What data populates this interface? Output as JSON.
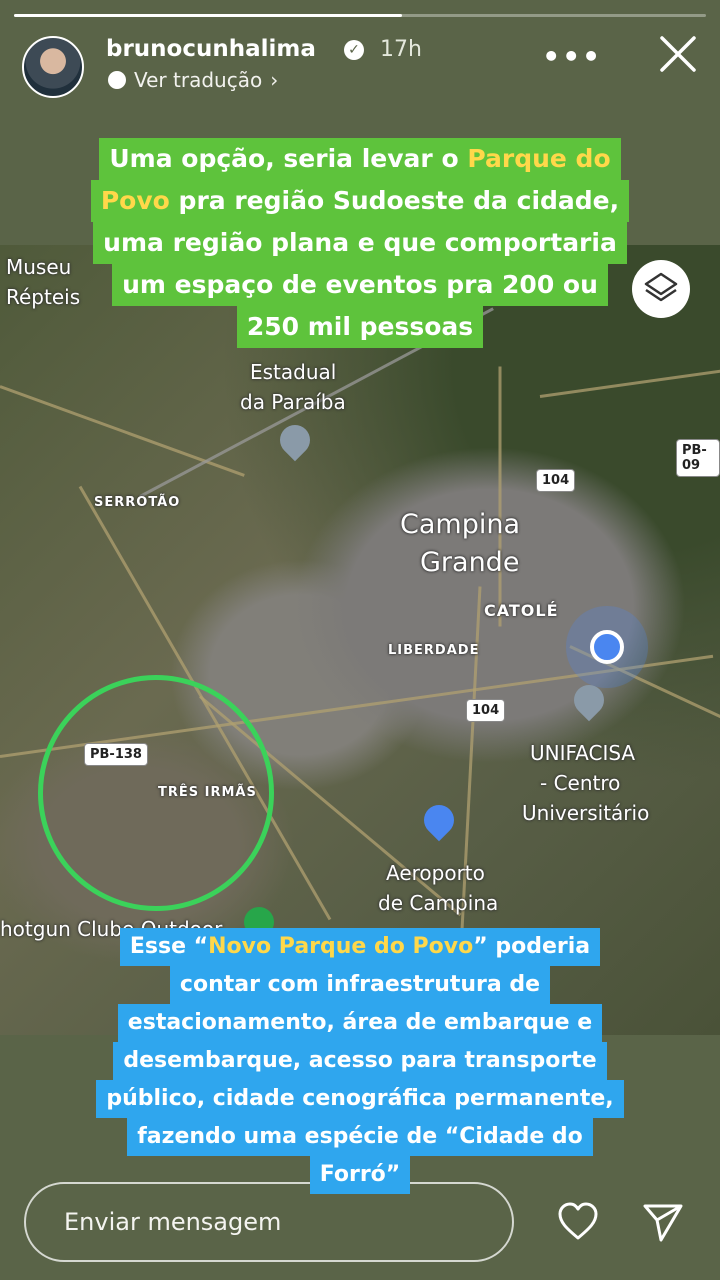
{
  "story": {
    "progress_fraction": 0.56,
    "username": "brunocunhalima",
    "time": "17h",
    "translate_label": "Ver tradução",
    "more_label": "•••"
  },
  "caption_top": {
    "lines": [
      {
        "pre": "Uma opção, seria levar o ",
        "hl": "Parque do",
        "post": ""
      },
      {
        "pre": "",
        "hl": "Povo",
        "post": " pra região Sudoeste da cidade,"
      },
      {
        "pre": "uma região plana e que comportaria",
        "hl": "",
        "post": ""
      },
      {
        "pre": "um espaço de eventos pra 200 ou",
        "hl": "",
        "post": ""
      },
      {
        "pre": "250 mil pessoas",
        "hl": "",
        "post": ""
      }
    ]
  },
  "map": {
    "labels": {
      "museu": "Museu",
      "repteis": "Répteis",
      "estadual": "Estadual",
      "paraiba": "da Paraíba",
      "serrotao": "SERROTÃO",
      "campina": "Campina",
      "grande": "Grande",
      "catole": "CATOLÉ",
      "liberdade": "LIBERDADE",
      "tres_irmas": "TRÊS IRMÃS",
      "unifacisa": "UNIFACISA",
      "centro": "- Centro",
      "universitario": "Universitário",
      "aeroporto": "Aeroporto",
      "de_campina": "de Campina",
      "shotgun": "hotgun Clube Outdoor"
    },
    "shields": {
      "pb09": "PB-09",
      "r104a": "104",
      "r104b": "104",
      "pb138": "PB-138"
    },
    "icons": [
      "layers-icon",
      "school-pin-icon",
      "airport-pin-icon",
      "location-dot-icon"
    ]
  },
  "caption_bottom": {
    "lines": [
      {
        "pre": "Esse “",
        "hl": "Novo Parque do Povo",
        "post": "” poderia"
      },
      {
        "pre": "contar com infraestrutura de",
        "hl": "",
        "post": ""
      },
      {
        "pre": "estacionamento, área de embarque e",
        "hl": "",
        "post": ""
      },
      {
        "pre": "desembarque, acesso para transporte",
        "hl": "",
        "post": ""
      },
      {
        "pre": "público, cidade cenográfica permanente,",
        "hl": "",
        "post": ""
      },
      {
        "pre": "fazendo uma espécie de “Cidade do",
        "hl": "",
        "post": ""
      },
      {
        "pre": "Forró”",
        "hl": "",
        "post": ""
      }
    ]
  },
  "footer": {
    "message_placeholder": "Enviar mensagem",
    "icons": [
      "heart-icon",
      "send-icon"
    ]
  },
  "colors": {
    "background": "#5a6448",
    "caption_green": "#5ec33c",
    "caption_blue": "#2fa6ee",
    "highlight": "#ffd84a",
    "circle": "#3bd25a"
  }
}
